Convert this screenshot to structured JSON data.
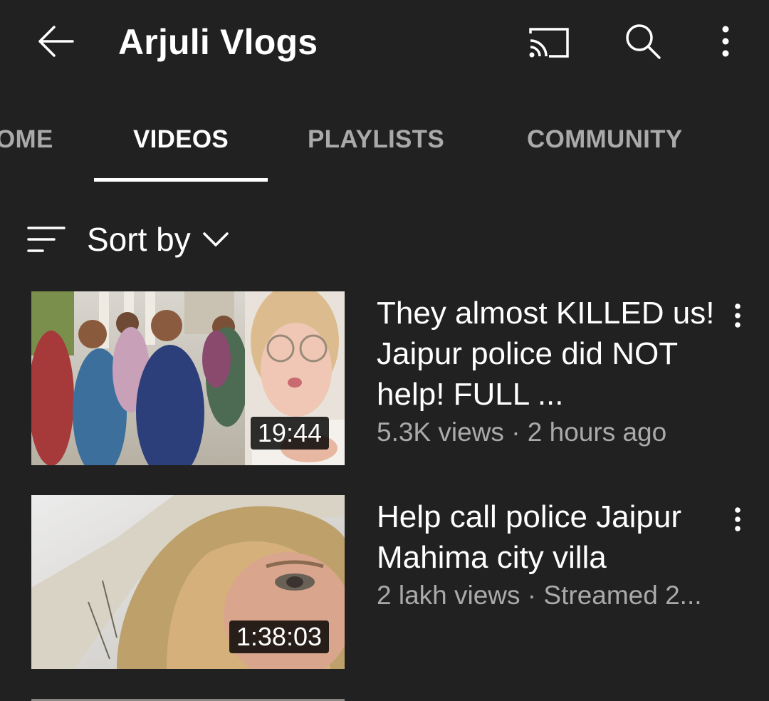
{
  "header": {
    "back_icon": "arrow-left-icon",
    "title": "Arjuli Vlogs",
    "cast_icon": "cast-icon",
    "search_icon": "search-icon",
    "more_icon": "more-vertical-icon"
  },
  "tabs": [
    {
      "label": "OME",
      "active": false
    },
    {
      "label": "VIDEOS",
      "active": true
    },
    {
      "label": "PLAYLISTS",
      "active": false
    },
    {
      "label": "COMMUNITY",
      "active": false
    }
  ],
  "sort": {
    "icon": "sort-icon",
    "label": "Sort by",
    "chevron": "chevron-down-icon"
  },
  "videos": [
    {
      "title": "They almost KILLED us! Jaipur police did NOT help! FULL ...",
      "meta": "5.3K views · 2 hours ago",
      "duration": "19:44"
    },
    {
      "title": "Help call police Jaipur Mahima city villa",
      "meta": "2 lakh views · Streamed 2...",
      "duration": "1:38:03"
    }
  ],
  "colors": {
    "background": "#212121",
    "text_primary": "#ffffff",
    "text_secondary": "#aaaaaa"
  }
}
